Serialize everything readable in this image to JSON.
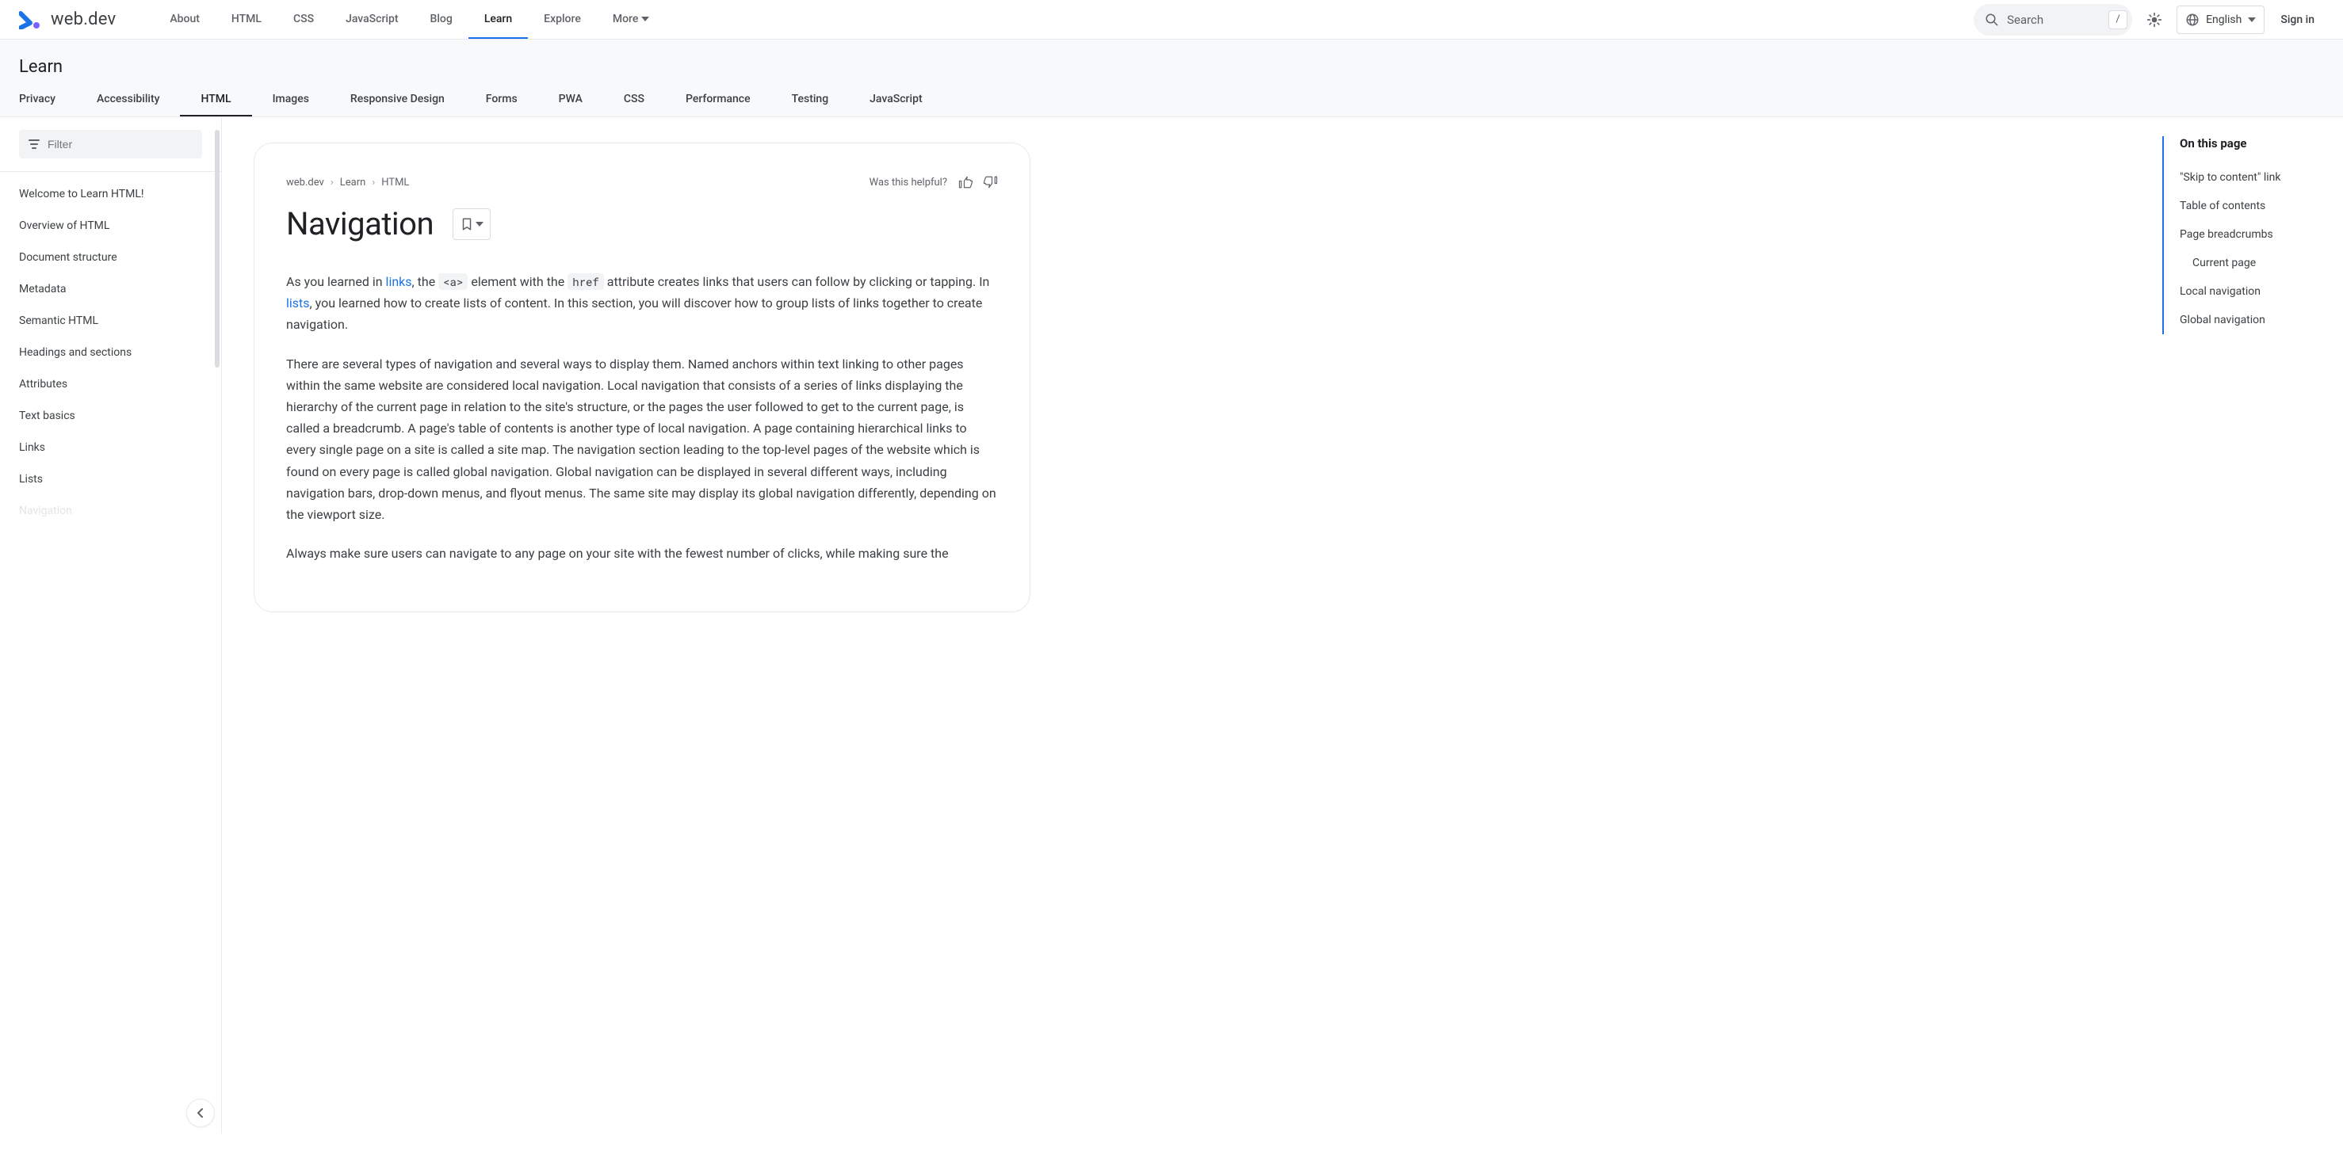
{
  "brand": "web.dev",
  "primary_nav": {
    "about": "About",
    "html": "HTML",
    "css": "CSS",
    "js": "JavaScript",
    "blog": "Blog",
    "learn": "Learn",
    "explore": "Explore",
    "more": "More"
  },
  "search": {
    "placeholder": "Search",
    "shortcut": "/"
  },
  "language": {
    "label": "English"
  },
  "signin": "Sign in",
  "section_title": "Learn",
  "sub_nav": {
    "privacy": "Privacy",
    "accessibility": "Accessibility",
    "html": "HTML",
    "images": "Images",
    "responsive": "Responsive Design",
    "forms": "Forms",
    "pwa": "PWA",
    "css": "CSS",
    "performance": "Performance",
    "testing": "Testing",
    "javascript": "JavaScript"
  },
  "sidebar": {
    "filter_placeholder": "Filter",
    "items": [
      "Welcome to Learn HTML!",
      "Overview of HTML",
      "Document structure",
      "Metadata",
      "Semantic HTML",
      "Headings and sections",
      "Attributes",
      "Text basics",
      "Links",
      "Lists",
      "Navigation"
    ]
  },
  "breadcrumbs": {
    "a": "web.dev",
    "b": "Learn",
    "c": "HTML"
  },
  "helpful_label": "Was this helpful?",
  "page_title": "Navigation",
  "body": {
    "p1a": "As you learned in ",
    "p1_link1": "links",
    "p1b": ", the ",
    "p1_code1": "<a>",
    "p1c": " element with the ",
    "p1_code2": "href",
    "p1d": " attribute creates links that users can follow by clicking or tapping. In ",
    "p1_link2": "lists",
    "p1e": ", you learned how to create lists of content. In this section, you will discover how to group lists of links together to create navigation.",
    "p2": "There are several types of navigation and several ways to display them. Named anchors within text linking to other pages within the same website are considered local navigation. Local navigation that consists of a series of links displaying the hierarchy of the current page in relation to the site's structure, or the pages the user followed to get to the current page, is called a breadcrumb. A page's table of contents is another type of local navigation. A page containing hierarchical links to every single page on a site is called a site map. The navigation section leading to the top-level pages of the website which is found on every page is called global navigation. Global navigation can be displayed in several different ways, including navigation bars, drop-down menus, and flyout menus. The same site may display its global navigation differently, depending on the viewport size.",
    "p3": "Always make sure users can navigate to any page on your site with the fewest number of clicks, while making sure the"
  },
  "toc": {
    "title": "On this page",
    "items": [
      {
        "label": "\"Skip to content\" link",
        "nested": false
      },
      {
        "label": "Table of contents",
        "nested": false
      },
      {
        "label": "Page breadcrumbs",
        "nested": false
      },
      {
        "label": "Current page",
        "nested": true
      },
      {
        "label": "Local navigation",
        "nested": false
      },
      {
        "label": "Global navigation",
        "nested": false
      }
    ]
  }
}
